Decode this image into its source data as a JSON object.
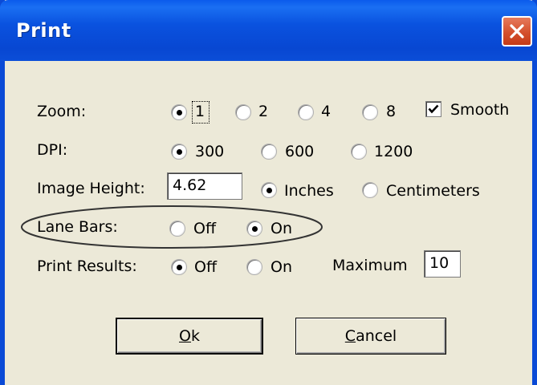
{
  "window": {
    "title": "Print",
    "close_icon": "close-icon"
  },
  "zoom": {
    "label": "Zoom:",
    "options": [
      "1",
      "2",
      "4",
      "8"
    ],
    "selected": "1",
    "smooth_label": "Smooth",
    "smooth_checked": true
  },
  "dpi": {
    "label": "DPI:",
    "options": [
      "300",
      "600",
      "1200"
    ],
    "selected": "300"
  },
  "image_height": {
    "label": "Image Height:",
    "value": "4.62",
    "units": [
      "Inches",
      "Centimeters"
    ],
    "selected_unit": "Inches"
  },
  "lane_bars": {
    "label": "Lane Bars:",
    "options": [
      "Off",
      "On"
    ],
    "selected": "On"
  },
  "print_results": {
    "label": "Print Results:",
    "options": [
      "Off",
      "On"
    ],
    "selected": "Off",
    "maximum_label": "Maximum",
    "maximum_value": "10"
  },
  "buttons": {
    "ok": "Ok",
    "cancel": "Cancel"
  },
  "colors": {
    "title_bar": "#0a52df",
    "dialog_bg": "#ece9d8",
    "close_button": "#d4502d"
  }
}
